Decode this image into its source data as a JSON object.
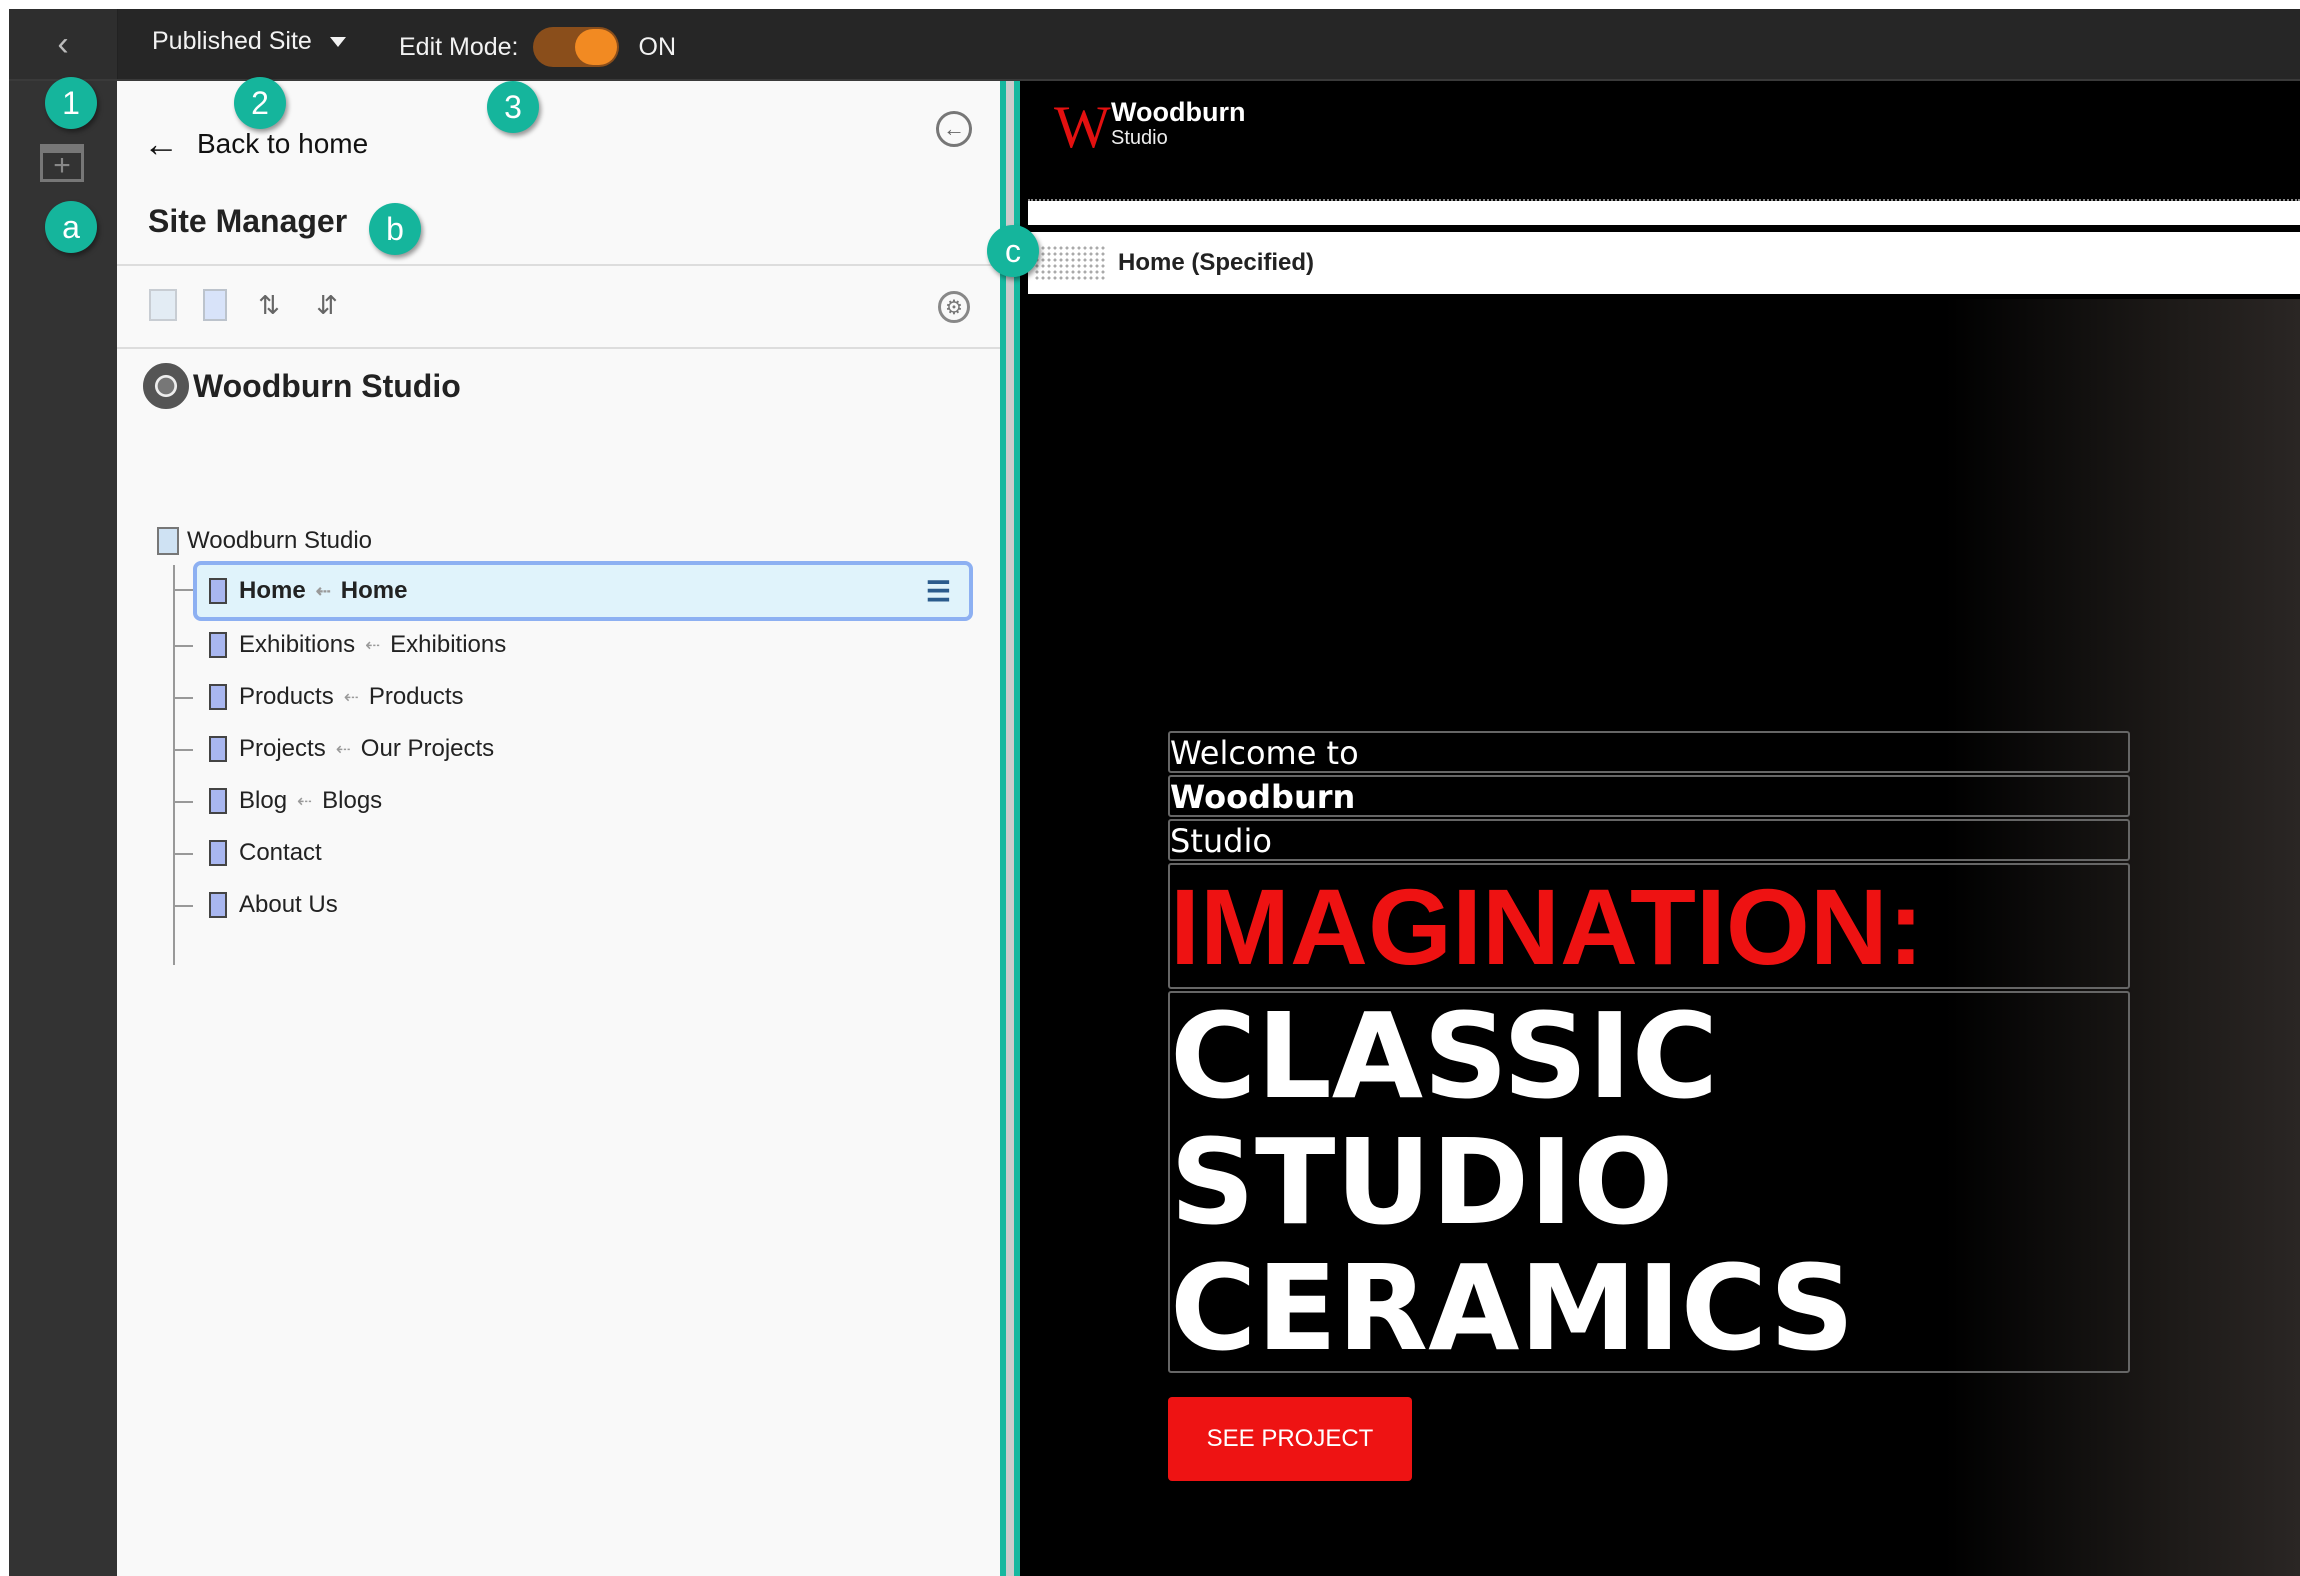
{
  "topbar": {
    "back_label": "<",
    "site_selector": "Published Site",
    "edit_mode_label": "Edit Mode:",
    "edit_mode_state": "ON",
    "edit_mode_on": true,
    "toggle_color": "#f28a22"
  },
  "panel": {
    "back_home": "Back to home",
    "title": "Site Manager",
    "site_name": "Woodburn Studio",
    "toolbar": [
      "new-page-icon",
      "new-document-icon",
      "expand-all-icon",
      "collapse-all-icon"
    ],
    "tree": {
      "root": "Woodburn Studio",
      "nodes": [
        {
          "name": "Home",
          "target": "Home",
          "selected": true
        },
        {
          "name": "Exhibitions",
          "target": "Exhibitions"
        },
        {
          "name": "Products",
          "target": "Products"
        },
        {
          "name": "Projects",
          "target": "Our Projects"
        },
        {
          "name": "Blog",
          "target": "Blogs"
        },
        {
          "name": "Contact",
          "target": ""
        },
        {
          "name": "About Us",
          "target": ""
        }
      ]
    }
  },
  "preview": {
    "logo_letter": "W",
    "logo_name": "Woodburn",
    "logo_sub": "Studio",
    "page_label": "Home (Specified)",
    "hero": {
      "line1": "Welcome to",
      "line2": "Woodburn",
      "line3": "Studio",
      "headline_red": "IMAGINATION:",
      "headline_white": [
        "CLASSIC",
        "STUDIO",
        "CERAMICS"
      ],
      "button": "SEE PROJECT"
    },
    "accent_red": "#ee1313"
  },
  "callouts": {
    "c1": "1",
    "c2": "2",
    "c3": "3",
    "ca": "a",
    "cb": "b",
    "cc": "c",
    "color": "#15b59c"
  }
}
